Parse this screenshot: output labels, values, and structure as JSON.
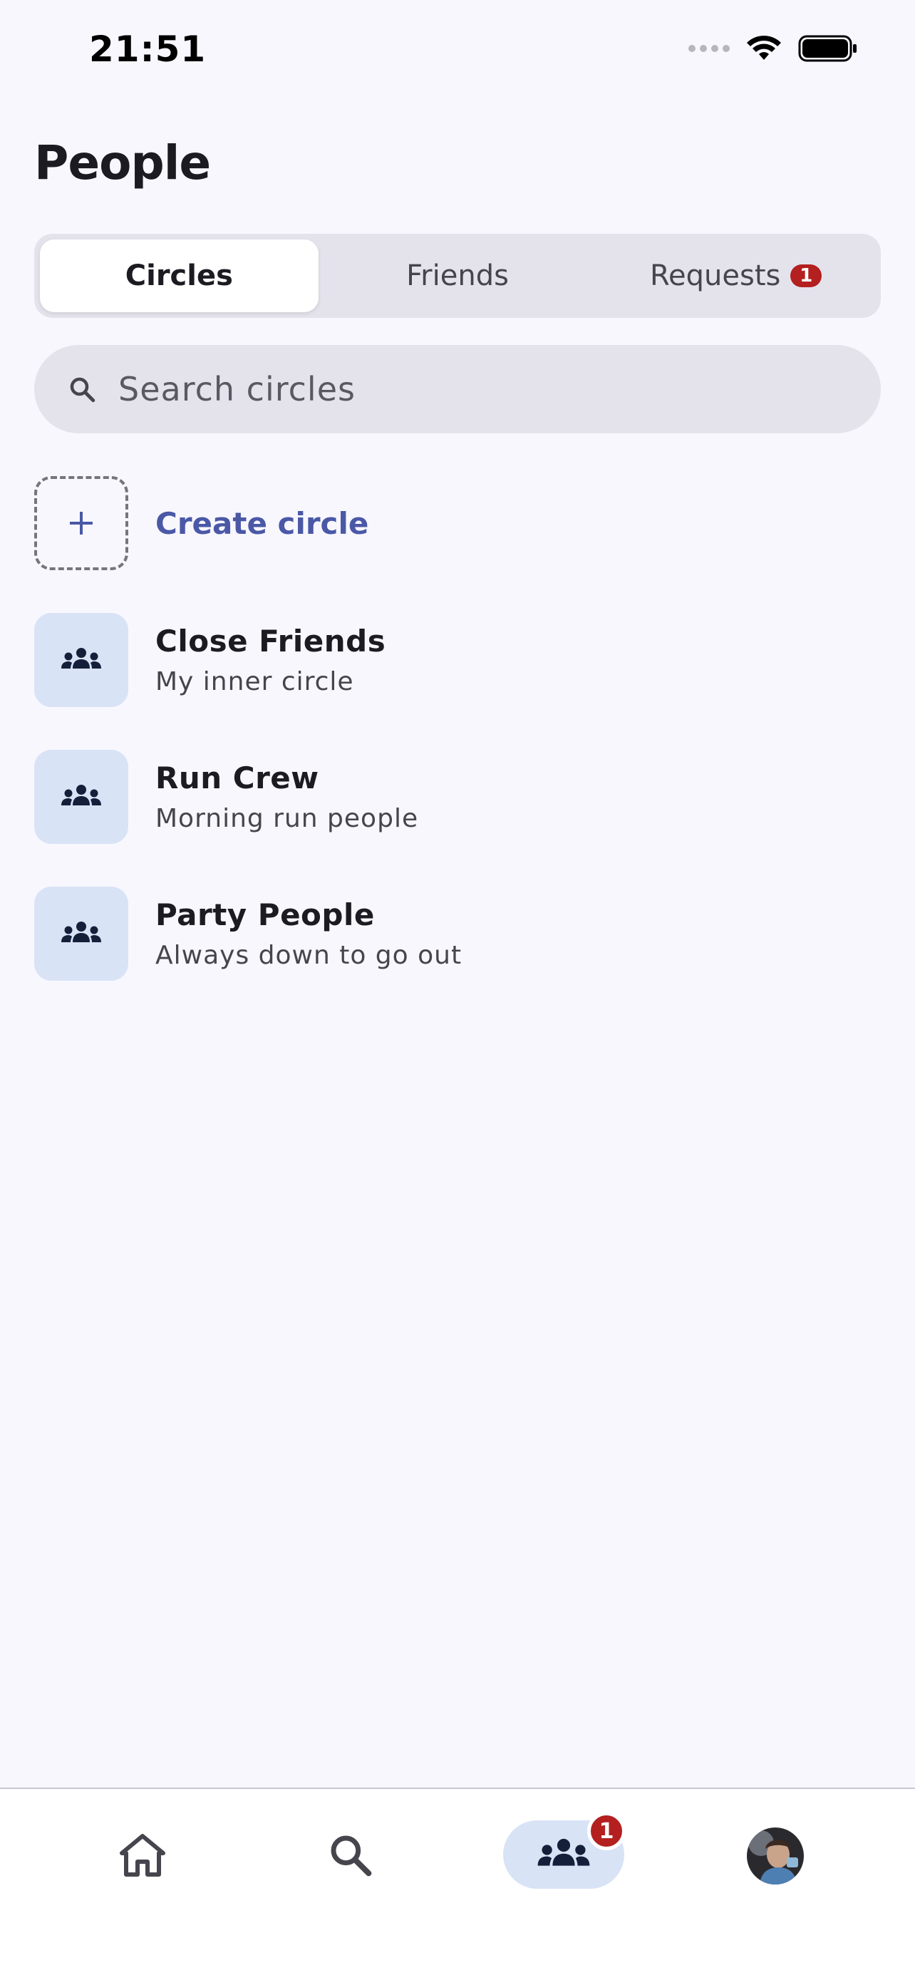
{
  "status_bar": {
    "time": "21:51"
  },
  "page": {
    "title": "People"
  },
  "tabs": [
    {
      "label": "Circles",
      "active": true
    },
    {
      "label": "Friends",
      "active": false
    },
    {
      "label": "Requests",
      "active": false,
      "badge": "1"
    }
  ],
  "search": {
    "placeholder": "Search circles"
  },
  "create": {
    "label": "Create circle",
    "icon": "plus-icon"
  },
  "circles": [
    {
      "title": "Close Friends",
      "subtitle": "My inner circle",
      "icon": "group-icon"
    },
    {
      "title": "Run Crew",
      "subtitle": "Morning run people",
      "icon": "group-icon"
    },
    {
      "title": "Party People",
      "subtitle": "Always down to go out",
      "icon": "group-icon"
    }
  ],
  "bottom_nav": {
    "items": [
      {
        "name": "home",
        "icon": "home-icon"
      },
      {
        "name": "search",
        "icon": "search-icon"
      },
      {
        "name": "people",
        "icon": "group-icon",
        "active": true,
        "badge": "1"
      },
      {
        "name": "profile",
        "icon": "avatar"
      }
    ]
  },
  "colors": {
    "background": "#f8f7fe",
    "accent": "#4a58a6",
    "badge": "#b3201f",
    "tile": "#d9e3f6"
  }
}
